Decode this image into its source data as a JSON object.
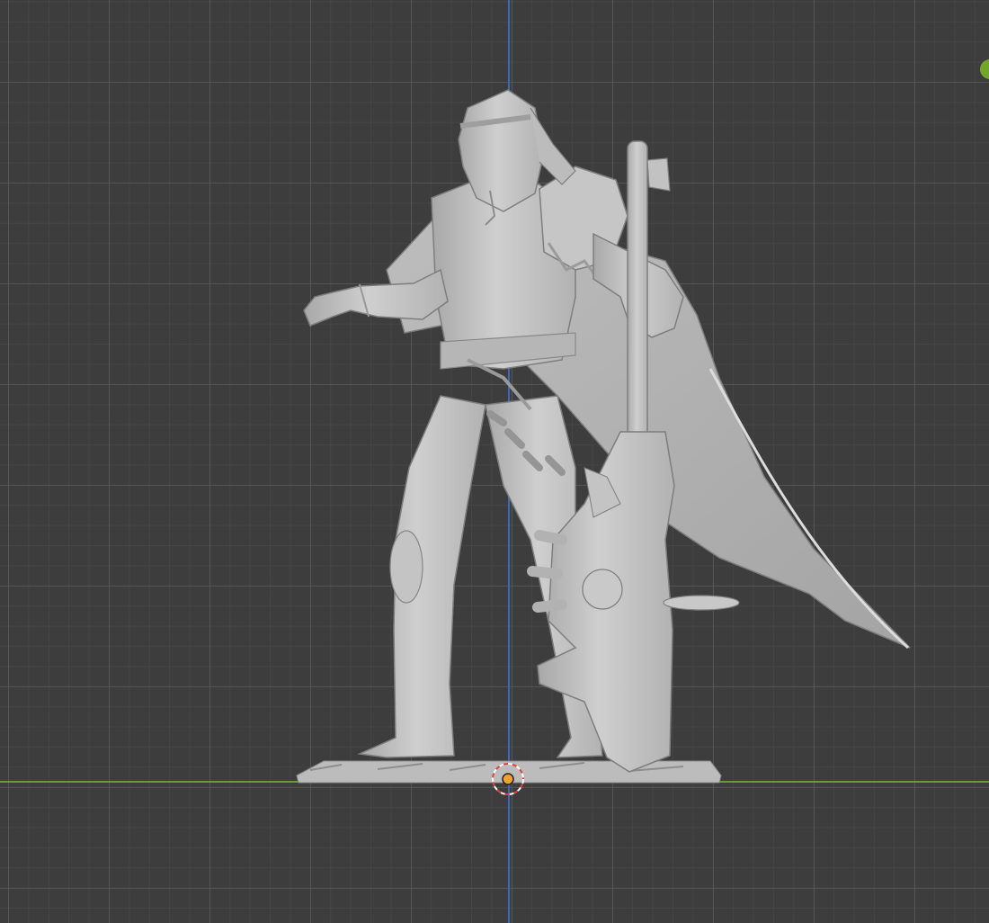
{
  "viewport": {
    "view": "front-orthographic",
    "background_color": "#3d3d3d",
    "grid_color": "#555555",
    "axis_colors": {
      "z_axis": "#3e6bb8",
      "y_axis": "#6c9a2f"
    },
    "object": {
      "name_icon": "sculpt-figure-mesh",
      "mesh_color": "#c9c9c9",
      "shade_color": "#9a9a9a"
    },
    "origin_marker": {
      "icon": "3d-cursor-icon",
      "dot_color": "#f0a030",
      "ring_colors": [
        "#e04040",
        "#ffffff"
      ]
    },
    "gizmo_indicator_color": "#74a52a"
  }
}
